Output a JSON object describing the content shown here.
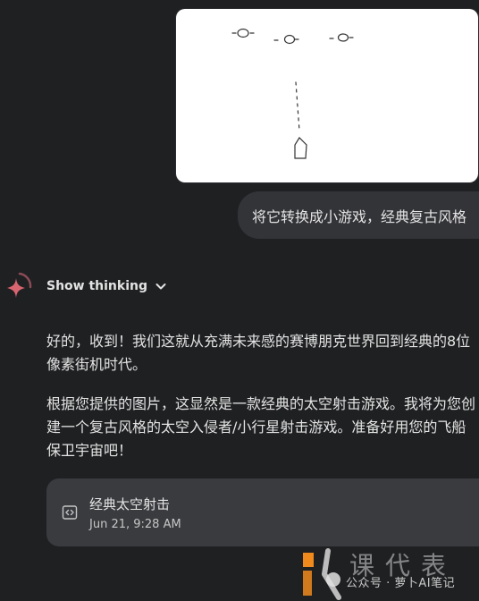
{
  "user_message": {
    "sketch_image_alt": "hand-drawn space shooter sketch",
    "text": "将它转换成小游戏，经典复古风格"
  },
  "assistant": {
    "icon": "gemini-sparkle-icon",
    "show_thinking_label": "Show thinking",
    "paragraphs": [
      "好的，收到！我们这就从充满未来感的赛博朋克世界回到经典的8位像素街机时代。",
      "根据您提供的图片，这显然是一款经典的太空射击游戏。我将为您创建一个复古风格的太空入侵者/小行星射击游戏。准备好用您的飞船保卫宇宙吧！"
    ],
    "artifact": {
      "icon": "code-icon",
      "title": "经典太空射击",
      "date": "Jun 21, 9:28 AM"
    }
  },
  "watermark": {
    "text": "公众号 · 萝卜AI笔记"
  },
  "colors": {
    "background": "#1f2022",
    "bubble": "#333438",
    "artifact_card": "#3a3b3f",
    "accent_sparkle": "#d96570",
    "watermark_orange": "#f08a1c"
  }
}
